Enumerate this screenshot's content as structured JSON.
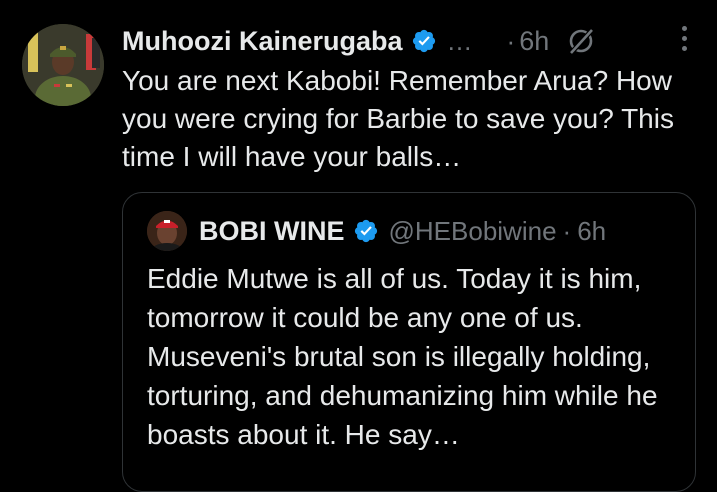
{
  "tweet": {
    "author_name": "Muhoozi Kainerugaba",
    "ellipsis": "…",
    "separator": "·",
    "time": "6h",
    "text": "You are next Kabobi! Remember Arua? How you were crying for Barbie to save you? This time I will have your balls…",
    "verified_color": "#1d9bf0",
    "icons": [
      "avatar",
      "verified-badge-icon",
      "grok-icon",
      "more-options-icon"
    ]
  },
  "quote": {
    "author_name": "BOBI WINE",
    "handle": "@HEBobiwine",
    "separator": "·",
    "time": "6h",
    "text": "Eddie Mutwe is all of us. Today it is him, tomorrow it could be any one of us. Museveni's brutal son is illegally holding, torturing, and dehumanizing him while he boasts about it. He say…"
  },
  "colors": {
    "background": "#000000",
    "text": "#e7e9ea",
    "muted": "#71767b",
    "border": "#2f3336",
    "accent": "#1d9bf0"
  }
}
